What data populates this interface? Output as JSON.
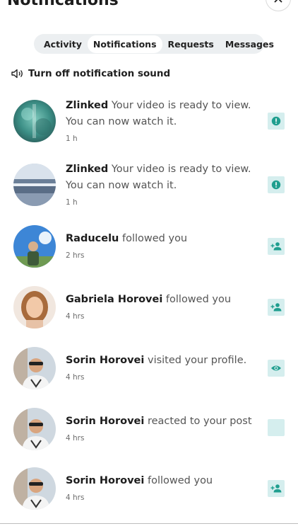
{
  "header": {
    "title": "Notifications"
  },
  "tabs": [
    {
      "label": "Activity",
      "active": false
    },
    {
      "label": "Notifications",
      "active": true
    },
    {
      "label": "Requests",
      "active": false
    },
    {
      "label": "Messages",
      "active": false
    }
  ],
  "sound_toggle": {
    "label": "Turn off notification sound",
    "icon": "speaker-off-icon"
  },
  "notifications": [
    {
      "name": "Zlinked",
      "message": "Your video is ready to view. You can now watch it.",
      "time": "1 h",
      "badge_icon": "alert-icon"
    },
    {
      "name": "Zlinked",
      "message": "Your video is ready to view. You can now watch it.",
      "time": "1 h",
      "badge_icon": "alert-icon"
    },
    {
      "name": "Raducelu",
      "message": "followed you",
      "time": "2 hrs",
      "badge_icon": "person-add-icon"
    },
    {
      "name": "Gabriela Horovei",
      "message": "followed you",
      "time": "4 hrs",
      "badge_icon": "person-add-icon"
    },
    {
      "name": "Sorin Horovei",
      "message": "visited your profile.",
      "time": "4 hrs",
      "badge_icon": "eye-icon"
    },
    {
      "name": "Sorin Horovei",
      "message": "reacted to your post",
      "time": "4 hrs",
      "badge_icon": "reaction-icon"
    },
    {
      "name": "Sorin Horovei",
      "message": "followed you",
      "time": "4 hrs",
      "badge_icon": "person-add-icon"
    }
  ],
  "colors": {
    "accent": "#1f9e8f",
    "badge_bg": "#d5eeee",
    "tabs_bg": "#eceff1"
  }
}
